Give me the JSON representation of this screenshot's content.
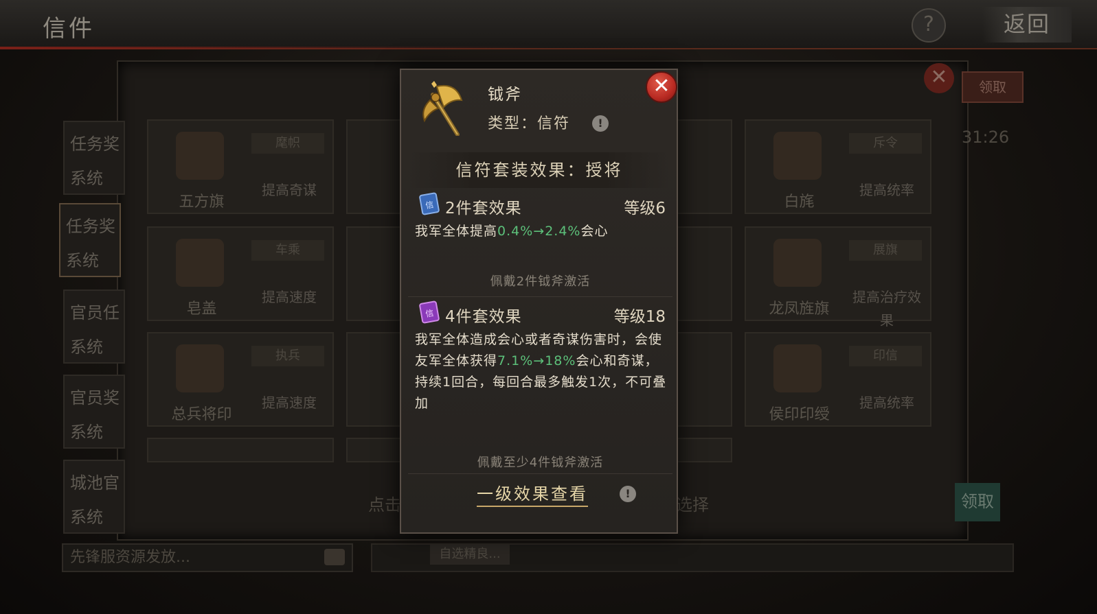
{
  "header": {
    "title": "信件",
    "help_label": "?",
    "back_label": "返回"
  },
  "background": {
    "close_label": "✕",
    "claim_top_label": "领取",
    "timer": "31:26",
    "sidebar": [
      {
        "line1": "任务奖",
        "line2": "系统"
      },
      {
        "line1": "任务奖",
        "line2": "系统"
      },
      {
        "line1": "官员任",
        "line2": "系统"
      },
      {
        "line1": "官员奖",
        "line2": "系统"
      },
      {
        "line1": "城池官",
        "line2": "系统"
      }
    ],
    "cards": [
      {
        "name": "五方旗",
        "tag": "麾帜",
        "effect": "提高奇谋"
      },
      {
        "name": "白旄",
        "tag": "斥令",
        "effect": "提高统率"
      },
      {
        "name": "皂盖",
        "tag": "车乘",
        "effect": "提高速度"
      },
      {
        "name": "龙凤旌旗",
        "tag": "展旗",
        "effect": "提高治疗效果"
      },
      {
        "name": "总兵将印",
        "tag": "执兵",
        "effect": "提高速度"
      },
      {
        "name": "侯印印绶",
        "tag": "印信",
        "effect": "提高统率"
      }
    ],
    "bottom_hint_left": "点击",
    "bottom_hint_right": "选择",
    "bottom_claim_label": "领取",
    "input_placeholder": "先锋服资源发放...",
    "select_button_label": "自选精良..."
  },
  "modal": {
    "item_name": "钺斧",
    "type_label": "类型：信符",
    "close_label": "✕",
    "set_header": "信符套装效果：授将",
    "effect2": {
      "icon_char": "信",
      "title": "2件套效果",
      "level": "等级6",
      "desc_prefix": "我军全体提高",
      "desc_green": "0.4%→2.4%",
      "desc_suffix": "会心",
      "note": "佩戴2件钺斧激活"
    },
    "effect4": {
      "icon_char": "信",
      "title": "4件套效果",
      "level": "等级18",
      "desc_part1": "我军全体造成会心或者奇谋伤害时，会使友军全体获得",
      "desc_green": "7.1%→18%",
      "desc_part2": "会心和奇谋，持续1回合，每回合最多触发1次，不可叠加",
      "note": "佩戴至少4件钺斧激活"
    },
    "detail_link": "一级效果查看",
    "info_label": "!"
  },
  "colors": {
    "accent_green": "#5cc07a",
    "close_red": "#b82a22",
    "gold_underline": "#c9a86a"
  }
}
